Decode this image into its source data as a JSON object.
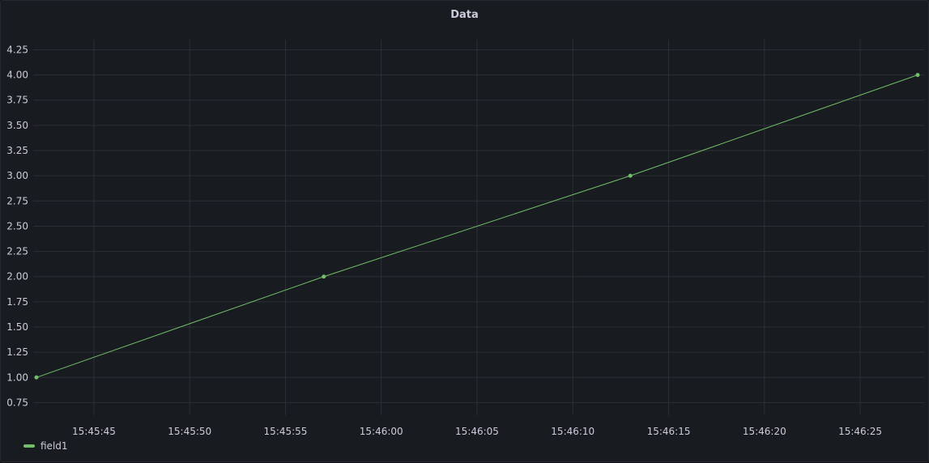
{
  "panel": {
    "title": "Data"
  },
  "colors": {
    "background": "#181b1f",
    "grid": "#2c3036",
    "tick_text": "#ccccdc",
    "series": "#73bf69"
  },
  "chart_data": {
    "type": "line",
    "title": "Data",
    "xlabel": "",
    "ylabel": "",
    "x_axis_type": "time",
    "xlim": [
      "15:45:42",
      "15:46:28"
    ],
    "ylim": [
      0.625,
      4.35
    ],
    "grid": true,
    "legend_position": "bottom-left",
    "x_ticks": [
      "15:45:45",
      "15:45:50",
      "15:45:55",
      "15:46:00",
      "15:46:05",
      "15:46:10",
      "15:46:15",
      "15:46:20",
      "15:46:25"
    ],
    "y_ticks": [
      "0.75",
      "1.00",
      "1.25",
      "1.50",
      "1.75",
      "2.00",
      "2.25",
      "2.50",
      "2.75",
      "3.00",
      "3.25",
      "3.50",
      "3.75",
      "4.00",
      "4.25"
    ],
    "series": [
      {
        "name": "field1",
        "color": "#73bf69",
        "points": [
          {
            "x": "15:45:42",
            "y": 1
          },
          {
            "x": "15:45:57",
            "y": 2
          },
          {
            "x": "15:46:13",
            "y": 3
          },
          {
            "x": "15:46:28",
            "y": 4
          }
        ]
      }
    ]
  }
}
